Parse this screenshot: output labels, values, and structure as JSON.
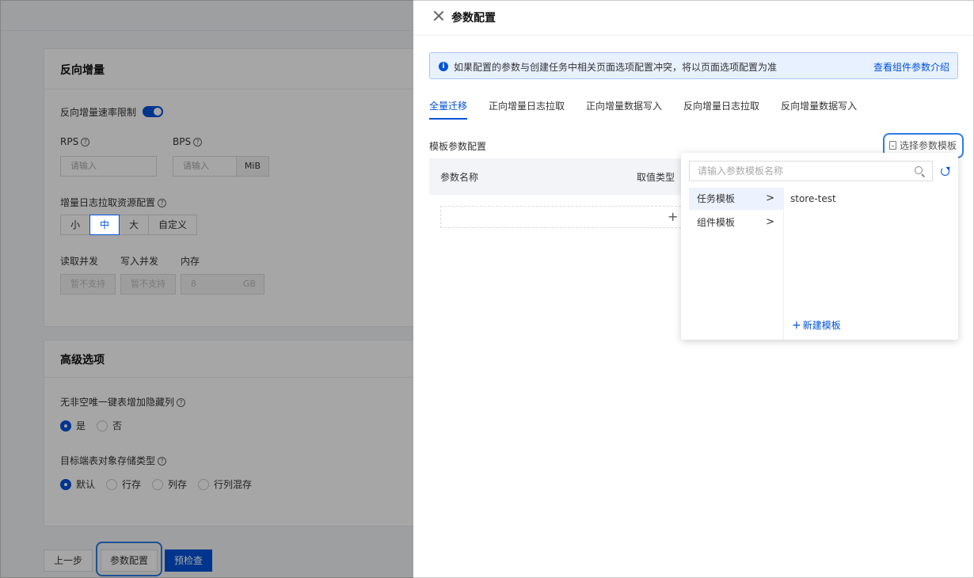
{
  "background": {
    "reverse_section": {
      "title": "反向增量",
      "rate_limit_label": "反向增量速率限制",
      "rps_label": "RPS",
      "bps_label": "BPS",
      "rps_placeholder": "请输入",
      "bps_placeholder": "请输入",
      "bps_unit": "MiB",
      "resource_label": "增量日志拉取资源配置",
      "resource_options": [
        "小",
        "中",
        "大",
        "自定义"
      ],
      "resource_selected": "中",
      "read_concurrency_label": "读取并发",
      "write_concurrency_label": "写入并发",
      "memory_label": "内存",
      "read_concurrency_value": "暂不支持",
      "write_concurrency_value": "暂不支持",
      "memory_value": "8",
      "memory_unit": "GB"
    },
    "advanced_section": {
      "title": "高级选项",
      "hidden_col_label": "无非空唯一键表增加隐藏列",
      "hidden_col_options": [
        "是",
        "否"
      ],
      "hidden_col_selected": "是",
      "storage_label": "目标端表对象存储类型",
      "storage_options": [
        "默认",
        "行存",
        "列存",
        "行列混存"
      ],
      "storage_selected": "默认"
    },
    "footer": {
      "prev_label": "上一步",
      "params_label": "参数配置",
      "precheck_label": "预检查"
    }
  },
  "drawer": {
    "title": "参数配置",
    "alert_text": "如果配置的参数与创建任务中相关页面选项配置冲突，将以页面选项配置为准",
    "alert_link": "查看组件参数介绍",
    "tabs": [
      "全量迁移",
      "正向增量日志拉取",
      "正向增量数据写入",
      "反向增量日志拉取",
      "反向增量数据写入"
    ],
    "active_tab": "全量迁移",
    "section_label": "模板参数配置",
    "select_template_label": "选择参数模板",
    "table_headers": {
      "name": "参数名称",
      "type": "取值类型"
    },
    "add_symbol": "+"
  },
  "popup": {
    "search_placeholder": "请输入参数模板名称",
    "categories": [
      {
        "label": "任务模板",
        "active": true
      },
      {
        "label": "组件模板",
        "active": false
      }
    ],
    "templates": [
      "store-test"
    ],
    "new_template_label": "新建模板"
  },
  "colors": {
    "primary": "#0052d9",
    "focus": "#2f7de1",
    "alert_bg": "#e8f1ff"
  }
}
